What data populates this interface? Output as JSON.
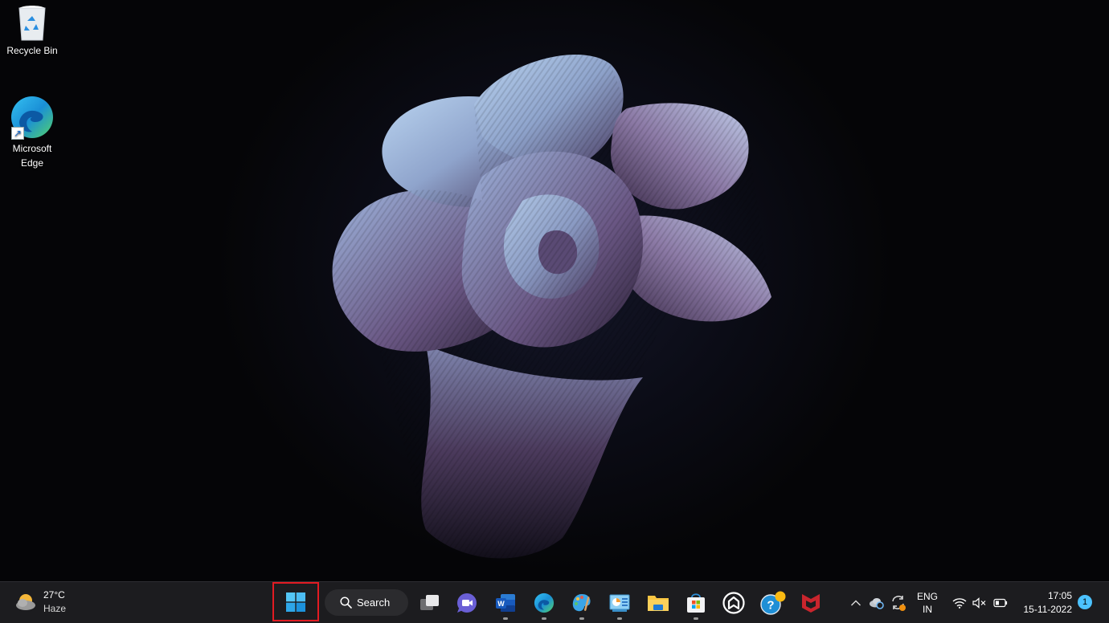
{
  "desktop": {
    "icons": [
      {
        "label": "Recycle Bin",
        "icon": "recycle-bin-icon"
      },
      {
        "label": "Microsoft\nEdge",
        "label_line1": "Microsoft",
        "label_line2": "Edge",
        "icon": "edge-icon",
        "shortcut": true
      }
    ],
    "wallpaper": {
      "name": "Windows 11 Bloom (dark)",
      "accent_colors": [
        "#a8c4e6",
        "#6e5a8a",
        "#3a2a48"
      ]
    }
  },
  "taskbar": {
    "weather": {
      "temperature": "27°C",
      "condition": "Haze",
      "icon": "haze-cloud-icon"
    },
    "start": {
      "icon": "windows-start-icon",
      "highlighted": true,
      "highlight_color": "#e21b22"
    },
    "search": {
      "label": "Search",
      "icon": "search-icon"
    },
    "apps": [
      {
        "name": "Task View",
        "icon": "task-view-icon",
        "running": false
      },
      {
        "name": "Chat",
        "icon": "teams-chat-icon",
        "running": false
      },
      {
        "name": "Microsoft Word",
        "icon": "word-icon",
        "running": true
      },
      {
        "name": "Microsoft Edge",
        "icon": "edge-icon",
        "running": true
      },
      {
        "name": "Paint",
        "icon": "paint-icon",
        "running": true
      },
      {
        "name": "Control Panel",
        "icon": "control-panel-icon",
        "running": true
      },
      {
        "name": "File Explorer",
        "icon": "file-explorer-icon",
        "running": false
      },
      {
        "name": "Microsoft Store",
        "icon": "store-icon",
        "running": true
      },
      {
        "name": "App",
        "icon": "house-outline-icon",
        "running": false
      },
      {
        "name": "Get Help",
        "icon": "help-icon",
        "running": false,
        "has_badge": true
      },
      {
        "name": "McAfee",
        "icon": "mcafee-icon",
        "running": false
      }
    ],
    "tray": {
      "overflow_icon": "chevron-up-icon",
      "onedrive_icon": "onedrive-sync-icon",
      "update_icon": "update-sync-icon",
      "language_line1": "ENG",
      "language_line2": "IN",
      "wifi_icon": "wifi-icon",
      "volume_icon": "volume-muted-icon",
      "battery_icon": "battery-icon",
      "time": "17:05",
      "date": "15-11-2022",
      "notification_count": "1"
    }
  }
}
